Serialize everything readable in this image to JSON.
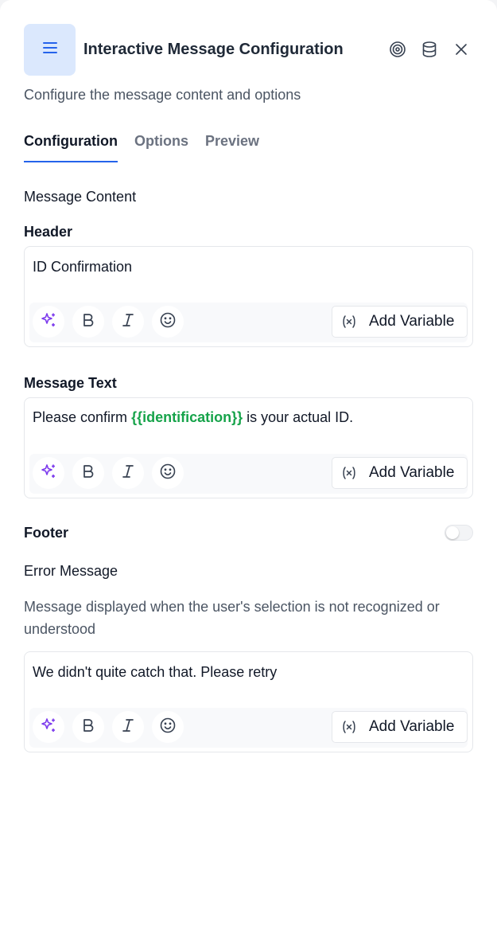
{
  "header": {
    "title": "Interactive Message Configuration",
    "subtitle": "Configure the message content and options",
    "icons": [
      "menu-icon",
      "target-icon",
      "database-icon",
      "close-icon"
    ]
  },
  "tabs": [
    {
      "label": "Configuration",
      "active": true
    },
    {
      "label": "Options",
      "active": false
    },
    {
      "label": "Preview",
      "active": false
    }
  ],
  "section_title": "Message Content",
  "fields": {
    "header": {
      "label": "Header",
      "value": "ID Confirmation"
    },
    "message_text": {
      "label": "Message Text",
      "value_before": "Please confirm ",
      "variable": "{{identification}}",
      "value_after": " is your actual ID."
    },
    "footer": {
      "label": "Footer",
      "enabled": false
    },
    "error_message": {
      "label": "Error Message",
      "description": "Message displayed when the user's selection is not recognized or understood",
      "value": "We didn't quite catch that. Please retry"
    }
  },
  "toolbar": {
    "add_variable_label": "Add Variable",
    "icons": [
      "sparkle-icon",
      "bold-icon",
      "italic-icon",
      "emoji-icon",
      "variable-icon"
    ]
  },
  "colors": {
    "accent": "#2563eb",
    "variable": "#16a34a",
    "sparkle": "#7c3aed",
    "menu_tile_bg": "#dbe8fd"
  }
}
